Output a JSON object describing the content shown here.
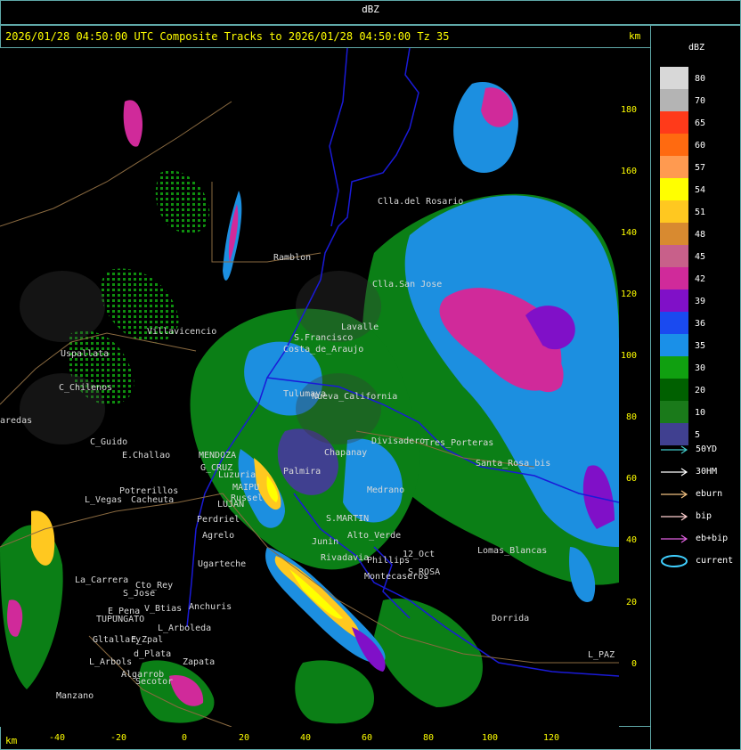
{
  "header": {
    "title": "dBZ",
    "subtitle": "2026/01/28 04:50:00 UTC Composite Tracks to 2026/01/28 04:50:00 Tz 35",
    "km_top": "km",
    "km_bottom": "km"
  },
  "axes": {
    "y_ticks": [
      "180",
      "160",
      "140",
      "120",
      "100",
      "80",
      "60",
      "40",
      "20",
      "0"
    ],
    "x_ticks": [
      "-40",
      "-20",
      "0",
      "20",
      "40",
      "60",
      "80",
      "100",
      "120"
    ]
  },
  "legend": {
    "title": "dBZ",
    "scale": [
      {
        "label": "80",
        "color": "#d8d8d8"
      },
      {
        "label": "70",
        "color": "#b4b4b4"
      },
      {
        "label": "65",
        "color": "#ff3a1a"
      },
      {
        "label": "60",
        "color": "#ff6a10"
      },
      {
        "label": "57",
        "color": "#ff9a50"
      },
      {
        "label": "54",
        "color": "#ffff00"
      },
      {
        "label": "51",
        "color": "#ffc820"
      },
      {
        "label": "48",
        "color": "#d88a30"
      },
      {
        "label": "45",
        "color": "#c8608a"
      },
      {
        "label": "42",
        "color": "#d02a9a"
      },
      {
        "label": "39",
        "color": "#8010c8"
      },
      {
        "label": "36",
        "color": "#1a4af0"
      },
      {
        "label": "35",
        "color": "#1a90e8"
      },
      {
        "label": "30",
        "color": "#10a010"
      },
      {
        "label": "20",
        "color": "#006000"
      },
      {
        "label": "10",
        "color": "#1a7a1a"
      },
      {
        "label": "5",
        "color": "#404090"
      }
    ],
    "tracks": [
      {
        "label": "50YD",
        "color": "#40c8c8"
      },
      {
        "label": "30HM",
        "color": "#ffffff"
      },
      {
        "label": "eburn",
        "color": "#f0c080"
      },
      {
        "label": "bip",
        "color": "#ffd0d0"
      },
      {
        "label": "eb+bip",
        "color": "#e060e0"
      },
      {
        "label": "current",
        "color": "#40d0ff"
      }
    ]
  },
  "places": [
    {
      "name": "Clla.del Rosario",
      "key": "clla-del-rosario"
    },
    {
      "name": "Ramblon",
      "key": "ramblon"
    },
    {
      "name": "Clla.San Jose",
      "key": "clla-san-jose"
    },
    {
      "name": "S.Francisco",
      "key": "s-francisco"
    },
    {
      "name": "Uspallata",
      "key": "uspallata"
    },
    {
      "name": "C_Chilenos",
      "key": "c-chilenos"
    },
    {
      "name": "aredas",
      "key": "aredas"
    },
    {
      "name": "C_Guido",
      "key": "c-guido"
    },
    {
      "name": "E.Challao",
      "key": "e-challao"
    },
    {
      "name": "MENDOZA",
      "key": "mendoza"
    },
    {
      "name": "G_CRUZ",
      "key": "g-cruz"
    },
    {
      "name": "Luzuria",
      "key": "luzuria"
    },
    {
      "name": "MAIPU",
      "key": "maipu"
    },
    {
      "name": "Russel",
      "key": "russel"
    },
    {
      "name": "LUJAN",
      "key": "lujan"
    },
    {
      "name": "Potrerillos",
      "key": "potrerillos"
    },
    {
      "name": "L_Vegas",
      "key": "l-vegas"
    },
    {
      "name": "Cacheuta",
      "key": "cacheuta"
    },
    {
      "name": "Perdriel",
      "key": "perdriel"
    },
    {
      "name": "Agrelo",
      "key": "agrelo"
    },
    {
      "name": "Ugarteche",
      "key": "ugarteche"
    },
    {
      "name": "La_Carrera",
      "key": "la-carrera"
    },
    {
      "name": "Cto_Rey",
      "key": "cto-rey"
    },
    {
      "name": "S_Jose",
      "key": "s-jose"
    },
    {
      "name": "E_Pena",
      "key": "e-pena"
    },
    {
      "name": "TUPUNGATO",
      "key": "tupungato"
    },
    {
      "name": "Anchuris",
      "key": "anchuris"
    },
    {
      "name": "V_Btias",
      "key": "v-btias"
    },
    {
      "name": "L_Arboleda",
      "key": "l-arboleda"
    },
    {
      "name": "Gltallary",
      "key": "gltallary"
    },
    {
      "name": "E_Zpal",
      "key": "e-zpal"
    },
    {
      "name": "d_Plata",
      "key": "d-plata"
    },
    {
      "name": "L_Arbols",
      "key": "l-arbols"
    },
    {
      "name": "Algarrob",
      "key": "algarrob"
    },
    {
      "name": "Zapata",
      "key": "zapata"
    },
    {
      "name": "Secotor",
      "key": "secotor"
    },
    {
      "name": "Manzano",
      "key": "manzano"
    },
    {
      "name": "Palmira",
      "key": "palmira"
    },
    {
      "name": "S.MARTIN",
      "key": "s-martin"
    },
    {
      "name": "Rivadavia",
      "key": "rivadavia"
    },
    {
      "name": "Junin",
      "key": "junin"
    },
    {
      "name": "Phillips",
      "key": "phillips"
    },
    {
      "name": "12_Oct",
      "key": "12-oct"
    },
    {
      "name": "S.ROSA",
      "key": "s-rosa"
    },
    {
      "name": "Lomas_Blancas",
      "key": "lomas-blancas"
    },
    {
      "name": "Dorrida",
      "key": "dorrida"
    },
    {
      "name": "L_PAZ",
      "key": "l-paz"
    },
    {
      "name": "Tres_Porteras",
      "key": "tres-porteras"
    },
    {
      "name": "Lavalle",
      "key": "lavalle"
    },
    {
      "name": "Villavicencio",
      "key": "villavicencio"
    },
    {
      "name": "Costa_de_Araujo",
      "key": "costa-de-araujo"
    },
    {
      "name": "Tulumaya",
      "key": "tulumaya"
    },
    {
      "name": "Medrano",
      "key": "medrano"
    },
    {
      "name": "Alto_Verde",
      "key": "alto-verde"
    },
    {
      "name": "Montecaseros",
      "key": "montecaseros"
    },
    {
      "name": "Divisadero",
      "key": "divisadero"
    },
    {
      "name": "Chapanay",
      "key": "chapanay"
    },
    {
      "name": "Nueva_California",
      "key": "nueva-california"
    },
    {
      "name": "Santa_Rosa_bis",
      "key": "santa-rosa-bis"
    }
  ]
}
